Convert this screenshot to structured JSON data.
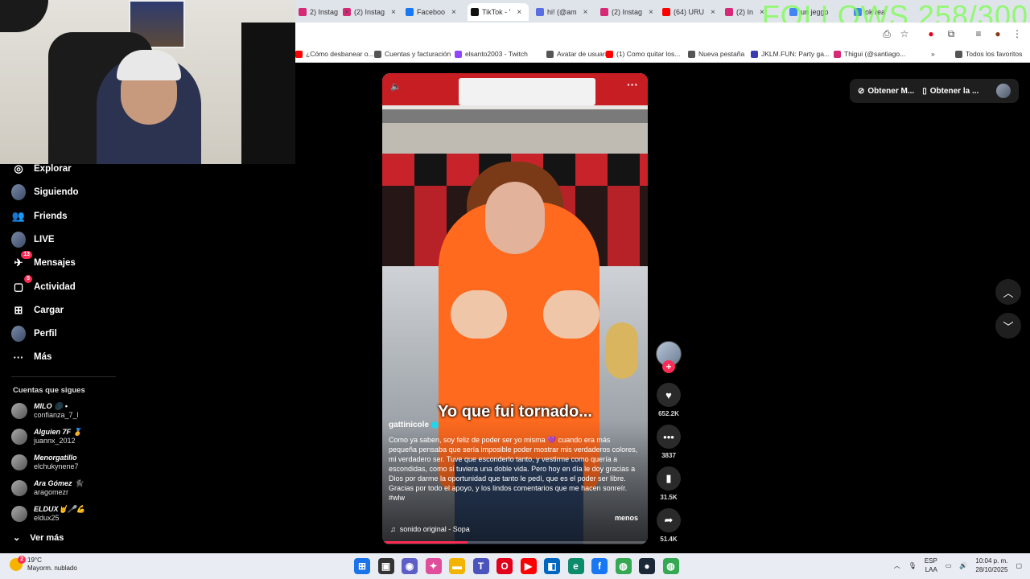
{
  "overlay": {
    "follows_text": "FOLLOWS 258/300"
  },
  "tabs": [
    {
      "label": "2) Instag",
      "color": "#d62976"
    },
    {
      "label": "(2) Instag",
      "color": "#d62976"
    },
    {
      "label": "Faceboo",
      "color": "#1877f2"
    },
    {
      "label": "TikTok - '",
      "color": "#111111"
    },
    {
      "label": "hi! (@am",
      "color": "#5b6ee1"
    },
    {
      "label": "(2) Instag",
      "color": "#d62976"
    },
    {
      "label": "(64) URU",
      "color": "#ff0000"
    },
    {
      "label": "(2) In",
      "color": "#d62976"
    },
    {
      "label": "un jeggo",
      "color": "#4285f4"
    },
    {
      "label": "ok rea",
      "color": "#4285f4"
    }
  ],
  "bookmarks": [
    {
      "label": "¿Cómo desbanear o...",
      "color": "#ff0000"
    },
    {
      "label": "Cuentas y facturación",
      "color": "#555555"
    },
    {
      "label": "elsanto2003 - Twitch",
      "color": "#9146ff"
    },
    {
      "label": "Avatar de usuario",
      "color": "#555555"
    },
    {
      "label": "(1) Como quitar los...",
      "color": "#ff0000"
    },
    {
      "label": "Nueva pestaña",
      "color": "#555555"
    },
    {
      "label": "JKLM.FUN: Party ga...",
      "color": "#3b3bb5"
    },
    {
      "label": "Thigui (@santiago...",
      "color": "#d62976"
    },
    {
      "label": "Todos los favoritos",
      "color": "#555555"
    }
  ],
  "sidebar": {
    "nav": [
      {
        "label": "Explorar",
        "icon": "compass-icon",
        "glyph": "◎",
        "badge": ""
      },
      {
        "label": "Siguiendo",
        "icon": "following-avatar-icon",
        "glyph": "",
        "badge": ""
      },
      {
        "label": "Friends",
        "icon": "friends-icon",
        "glyph": "👥",
        "badge": ""
      },
      {
        "label": "LIVE",
        "icon": "live-avatar-icon",
        "glyph": "",
        "badge": ""
      },
      {
        "label": "Mensajes",
        "icon": "messages-icon",
        "glyph": "✈",
        "badge": "13"
      },
      {
        "label": "Actividad",
        "icon": "activity-icon",
        "glyph": "▢",
        "badge": "5"
      },
      {
        "label": "Cargar",
        "icon": "upload-icon",
        "glyph": "⊞",
        "badge": ""
      },
      {
        "label": "Perfil",
        "icon": "profile-avatar-icon",
        "glyph": "",
        "badge": ""
      },
      {
        "label": "Más",
        "icon": "more-icon",
        "glyph": "···",
        "badge": ""
      }
    ],
    "following_title": "Cuentas que sigues",
    "following": [
      {
        "name": "MILO 🌑 •",
        "handle": "confianza_7_l"
      },
      {
        "name": "Alguien 7F 🏅",
        "handle": "juannx_2012"
      },
      {
        "name": "Menorgatillo",
        "handle": "elchukynene7"
      },
      {
        "name": "Ara Gómez 🐈‍⬛",
        "handle": "aragomezr"
      },
      {
        "name": "ELDUX🤘🎤💪",
        "handle": "eldux25"
      }
    ],
    "see_more": "Ver más"
  },
  "video": {
    "caption_overlay": "Yo que fui tornado...",
    "username": "gattinicole",
    "description": "Como ya saben, soy feliz de poder ser yo misma 💜 cuando era más pequeña pensaba que sería imposible poder mostrar mis verdaderos colores, mi verdadero ser. Tuve que esconderlo tanto, y vestirme como quería a escondidas, como si tuviera una doble vida. Pero hoy en día le doy gracias a Dios por darme la oportunidad que tanto le pedí, que es el poder ser libre. Gracias por todo el apoyo, y los lindos comentarios que me hacen sonreír. #wlw",
    "less_label": "menos",
    "sound": "sonido original - Sopa",
    "progress": 0.32
  },
  "actions": {
    "likes": "652.2K",
    "comments": "3837",
    "saves": "31.5K",
    "shares": "51.4K"
  },
  "top_right": {
    "get_coins": "Obtener M...",
    "get_app": "Obtener la ..."
  },
  "taskbar": {
    "temp": "19°C",
    "weather": "Mayorm. nublado",
    "weather_badge": "2",
    "lang_top": "ESP",
    "lang_bottom": "LAA",
    "time": "10:04 p. m.",
    "date": "28/10/2025",
    "apps": [
      {
        "name": "windows-start-icon",
        "color": "#1a73e8",
        "glyph": "⊞"
      },
      {
        "name": "task-view-icon",
        "color": "#333333",
        "glyph": "▣"
      },
      {
        "name": "chat-icon",
        "color": "#5b5fc7",
        "glyph": "◉"
      },
      {
        "name": "copilot-icon",
        "color": "#e04e9b",
        "glyph": "✦"
      },
      {
        "name": "file-explorer-icon",
        "color": "#f2b400",
        "glyph": "▬"
      },
      {
        "name": "teams-icon",
        "color": "#4b53bc",
        "glyph": "T"
      },
      {
        "name": "opera-icon",
        "color": "#e3001b",
        "glyph": "O"
      },
      {
        "name": "youtube-icon",
        "color": "#ff0000",
        "glyph": "▶"
      },
      {
        "name": "store-icon",
        "color": "#0067c0",
        "glyph": "◧"
      },
      {
        "name": "edge-icon",
        "color": "#0c8c6a",
        "glyph": "e"
      },
      {
        "name": "facebook-icon",
        "color": "#1877f2",
        "glyph": "f"
      },
      {
        "name": "chrome-icon",
        "color": "#34a853",
        "glyph": "◍"
      },
      {
        "name": "steam-icon",
        "color": "#1b2838",
        "glyph": "●"
      },
      {
        "name": "chrome-profile-icon",
        "color": "#34a853",
        "glyph": "◍"
      }
    ]
  }
}
